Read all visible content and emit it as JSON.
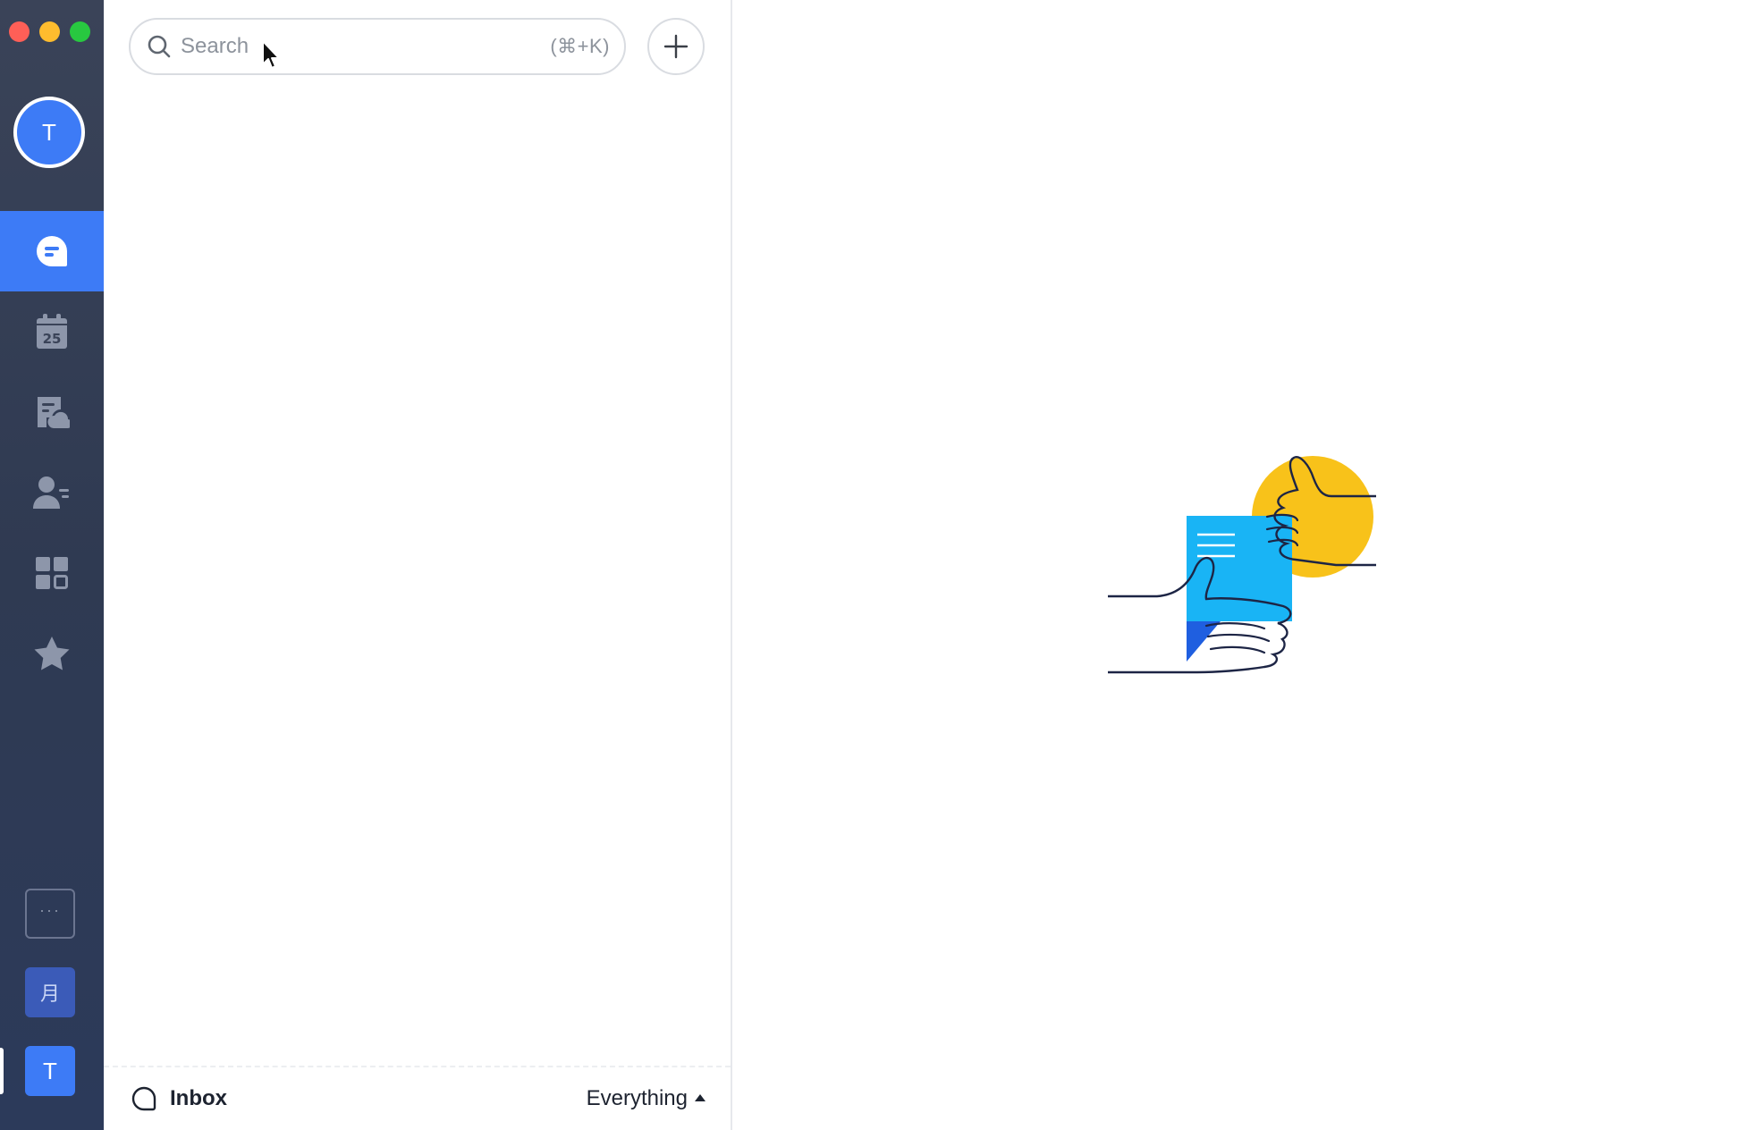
{
  "window": {
    "traffic_lights": [
      "close",
      "minimize",
      "zoom"
    ]
  },
  "rail": {
    "avatar_initial": "T",
    "items": [
      {
        "name": "chat",
        "icon": "chat-bubble-icon",
        "active": true
      },
      {
        "name": "calendar",
        "icon": "calendar-icon",
        "label": "25",
        "active": false
      },
      {
        "name": "docs",
        "icon": "document-cloud-icon",
        "active": false
      },
      {
        "name": "contacts",
        "icon": "contacts-icon",
        "active": false
      },
      {
        "name": "workplace",
        "icon": "grid-apps-icon",
        "active": false
      },
      {
        "name": "favorites",
        "icon": "star-icon",
        "active": false
      }
    ],
    "more_label": "···",
    "workspaces": [
      {
        "label": "月"
      },
      {
        "label": "T"
      }
    ],
    "colors": {
      "active": "#3d7bf6"
    }
  },
  "search": {
    "placeholder": "Search",
    "shortcut": "(⌘+K)"
  },
  "footer": {
    "inbox_label": "Inbox",
    "filter_label": "Everything"
  }
}
